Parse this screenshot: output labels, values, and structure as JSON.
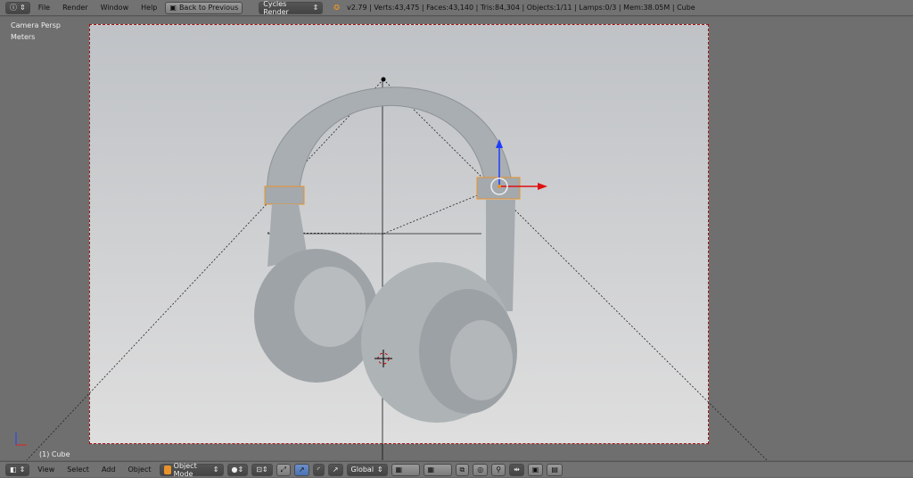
{
  "top_bar": {
    "menus": [
      "File",
      "Render",
      "Window",
      "Help"
    ],
    "back_button": "Back to Previous",
    "render_engine": "Cycles Render",
    "stats": "v2.79 | Verts:43,475 | Faces:43,140 | Tris:84,304 | Objects:1/11 | Lamps:0/3 | Mem:38.05M | Cube"
  },
  "viewport": {
    "view_name": "Camera Persp",
    "units": "Meters",
    "object_label": "(1) Cube"
  },
  "bottom_bar": {
    "menus": [
      "View",
      "Select",
      "Add",
      "Object"
    ],
    "mode": "Object Mode",
    "orientation": "Global"
  },
  "colors": {
    "header": "#727272",
    "camera_border": "#a01010",
    "selection": "#e8932a"
  }
}
